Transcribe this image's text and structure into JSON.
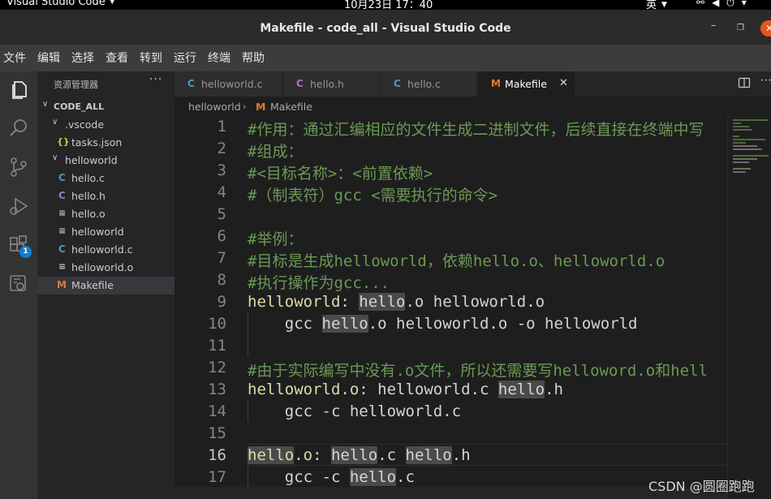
{
  "topbar": {
    "app_name": "Visual Studio Code",
    "clock": "10月23日  17：40",
    "input_method": "英"
  },
  "window": {
    "title": "Makefile - code_all - Visual Studio Code"
  },
  "menu": [
    "文件",
    "编辑",
    "选择",
    "查看",
    "转到",
    "运行",
    "终端",
    "帮助"
  ],
  "activity_bar": {
    "icons": [
      "files-icon",
      "search-icon",
      "source-control-icon",
      "run-debug-icon",
      "extensions-icon",
      "remote-explorer-icon"
    ],
    "extensions_badge": "1"
  },
  "explorer": {
    "title": "资源管理器",
    "more": "···",
    "root": "CODE_ALL",
    "items": [
      {
        "label": ".vscode",
        "icon": "folder-open",
        "depth": 1
      },
      {
        "label": "tasks.json",
        "icon": "json",
        "depth": 2
      },
      {
        "label": "helloworld",
        "icon": "folder-open",
        "depth": 1
      },
      {
        "label": "hello.c",
        "icon": "C",
        "depth": 2
      },
      {
        "label": "hello.h",
        "icon": "C",
        "depth": 2
      },
      {
        "label": "hello.o",
        "icon": "generic",
        "depth": 2
      },
      {
        "label": "helloworld",
        "icon": "generic",
        "depth": 2
      },
      {
        "label": "helloworld.c",
        "icon": "C",
        "depth": 2
      },
      {
        "label": "helloworld.o",
        "icon": "generic",
        "depth": 2
      },
      {
        "label": "Makefile",
        "icon": "M",
        "depth": 1,
        "selected": true
      }
    ]
  },
  "tabs": [
    {
      "label": "helloworld.c",
      "icon": "C",
      "active": false
    },
    {
      "label": "hello.h",
      "icon": "C",
      "active": false
    },
    {
      "label": "hello.c",
      "icon": "C",
      "active": false
    },
    {
      "label": "Makefile",
      "icon": "M",
      "active": true
    }
  ],
  "breadcrumb": {
    "folder": "helloworld",
    "file": "Makefile"
  },
  "editor": {
    "current_line": 16,
    "lines": [
      {
        "n": "1",
        "text": "#作用：通过汇编相应的文件生成二进制文件，后续直接在终端中写"
      },
      {
        "n": "2",
        "text": "#组成："
      },
      {
        "n": "3",
        "text": "#<目标名称>：<前置依赖>"
      },
      {
        "n": "4",
        "text": "#（制表符）gcc <需要执行的命令>"
      },
      {
        "n": "5",
        "text": ""
      },
      {
        "n": "6",
        "text": "#举例："
      },
      {
        "n": "7",
        "text": "#目标是生成helloworld，依赖hello.o、helloworld.o"
      },
      {
        "n": "8",
        "text": "#执行操作为gcc..."
      },
      {
        "n": "9",
        "text": "helloworld: hello.o helloworld.o"
      },
      {
        "n": "10",
        "text": "    gcc hello.o helloworld.o -o helloworld"
      },
      {
        "n": "11",
        "text": ""
      },
      {
        "n": "12",
        "text": "#由于实际编写中没有.o文件，所以还需要写helloword.o和hell"
      },
      {
        "n": "13",
        "text": "helloworld.o: helloworld.c hello.h"
      },
      {
        "n": "14",
        "text": "    gcc -c helloworld.c"
      },
      {
        "n": "15",
        "text": ""
      },
      {
        "n": "16",
        "text": "hello.o: hello.c hello.h"
      },
      {
        "n": "17",
        "text": "    gcc -c hello.c"
      }
    ]
  },
  "watermark": "CSDN @圆圈跑跑",
  "colors": {
    "comment": "#6a9955",
    "target": "#dcdcaa",
    "highlight": "#4a4a4a",
    "accent_badge": "#0e7fd4",
    "close_button": "#e95420"
  }
}
